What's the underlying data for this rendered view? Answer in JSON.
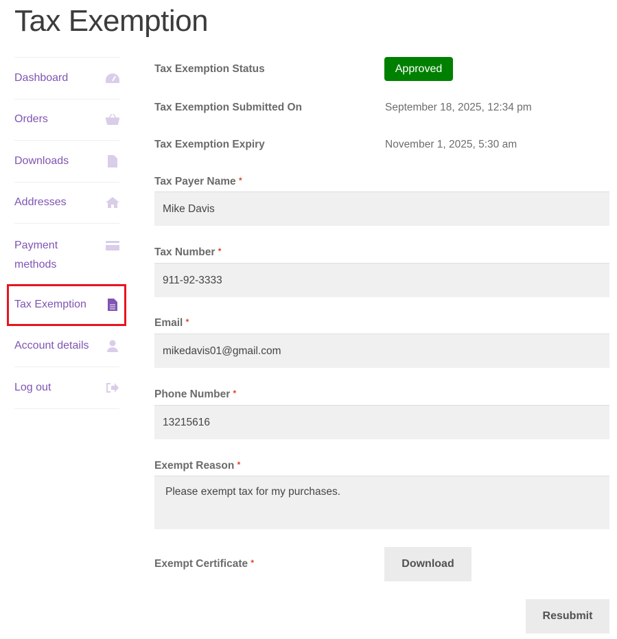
{
  "page_title": "Tax Exemption",
  "nav": [
    {
      "label": "Dashboard",
      "icon": "dashboard-icon"
    },
    {
      "label": "Orders",
      "icon": "basket-icon"
    },
    {
      "label": "Downloads",
      "icon": "file-archive-icon"
    },
    {
      "label": "Addresses",
      "icon": "home-icon"
    },
    {
      "label": "Payment methods",
      "icon": "credit-card-icon"
    },
    {
      "label": "Tax Exemption",
      "icon": "document-icon",
      "active": true
    },
    {
      "label": "Account details",
      "icon": "user-icon"
    },
    {
      "label": "Log out",
      "icon": "logout-icon"
    }
  ],
  "status": {
    "label": "Tax Exemption Status",
    "value": "Approved",
    "color": "#008000"
  },
  "submitted": {
    "label": "Tax Exemption Submitted On",
    "value": "September 18, 2025, 12:34 pm"
  },
  "expiry": {
    "label": "Tax Exemption Expiry",
    "value": "November 1, 2025, 5:30 am"
  },
  "fields": {
    "payer": {
      "label": "Tax Payer Name",
      "value": "Mike Davis"
    },
    "number": {
      "label": "Tax Number",
      "value": "911-92-3333"
    },
    "email": {
      "label": "Email",
      "value": "mikedavis01@gmail.com"
    },
    "phone": {
      "label": "Phone Number",
      "value": "13215616"
    },
    "reason": {
      "label": "Exempt Reason",
      "value": "Please exempt tax for my purchases."
    },
    "certificate": {
      "label": "Exempt Certificate"
    }
  },
  "required_mark": "*",
  "download_label": "Download",
  "resubmit_label": "Resubmit"
}
